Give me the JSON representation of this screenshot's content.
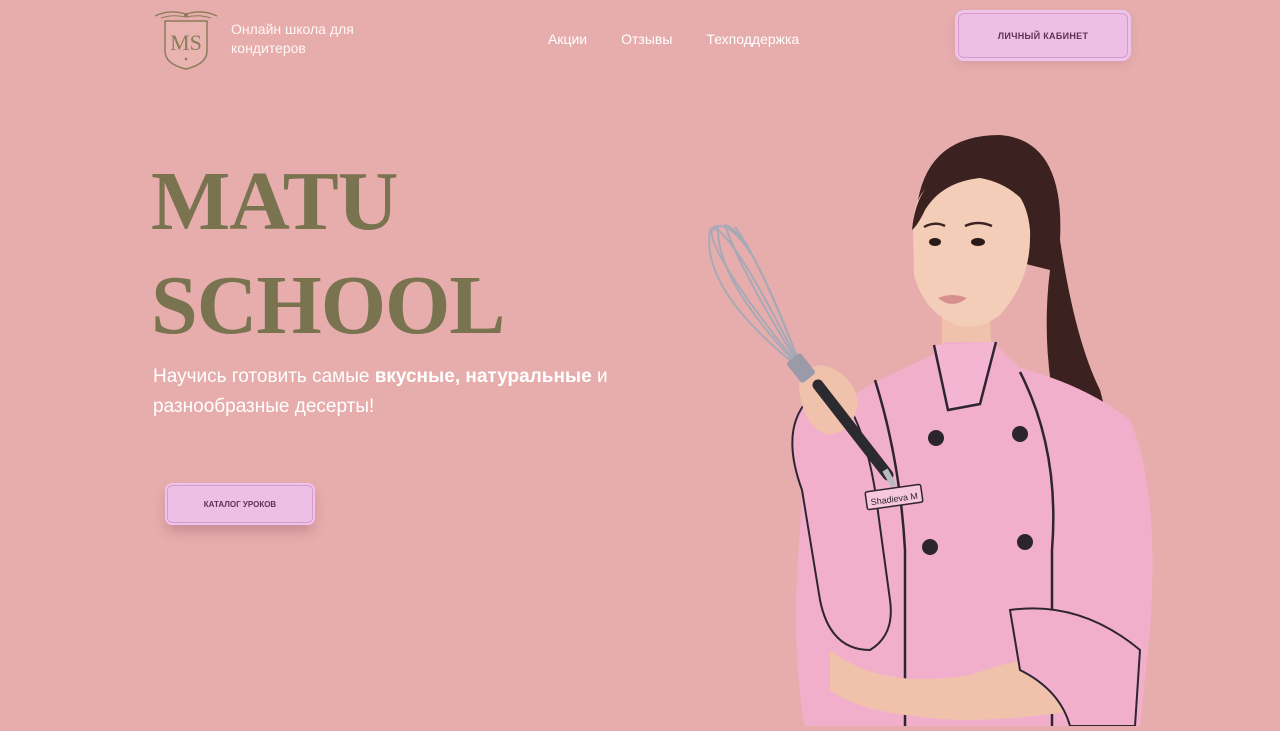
{
  "header": {
    "logo_monogram": "MS",
    "tagline": "Онлайн школа для кондитеров",
    "nav": [
      {
        "label": "Акции"
      },
      {
        "label": "Отзывы"
      },
      {
        "label": "Техподдержка"
      }
    ],
    "cabinet_button": "ЛИЧНЫЙ КАБИНЕТ"
  },
  "hero": {
    "title_line1": "MATU",
    "title_line2": "SCHOOL",
    "subtitle_part1": "Научись готовить самые ",
    "subtitle_bold": "вкусные, натуральные",
    "subtitle_part2": " и разнообразные десерты!",
    "catalog_button": "КАТАЛОГ УРОКОВ"
  },
  "image": {
    "name_badge": "Shadieva M"
  },
  "colors": {
    "background": "#e6adac",
    "title": "#7a7350",
    "button_bg": "#eebfe6",
    "button_text": "#5b3452"
  }
}
